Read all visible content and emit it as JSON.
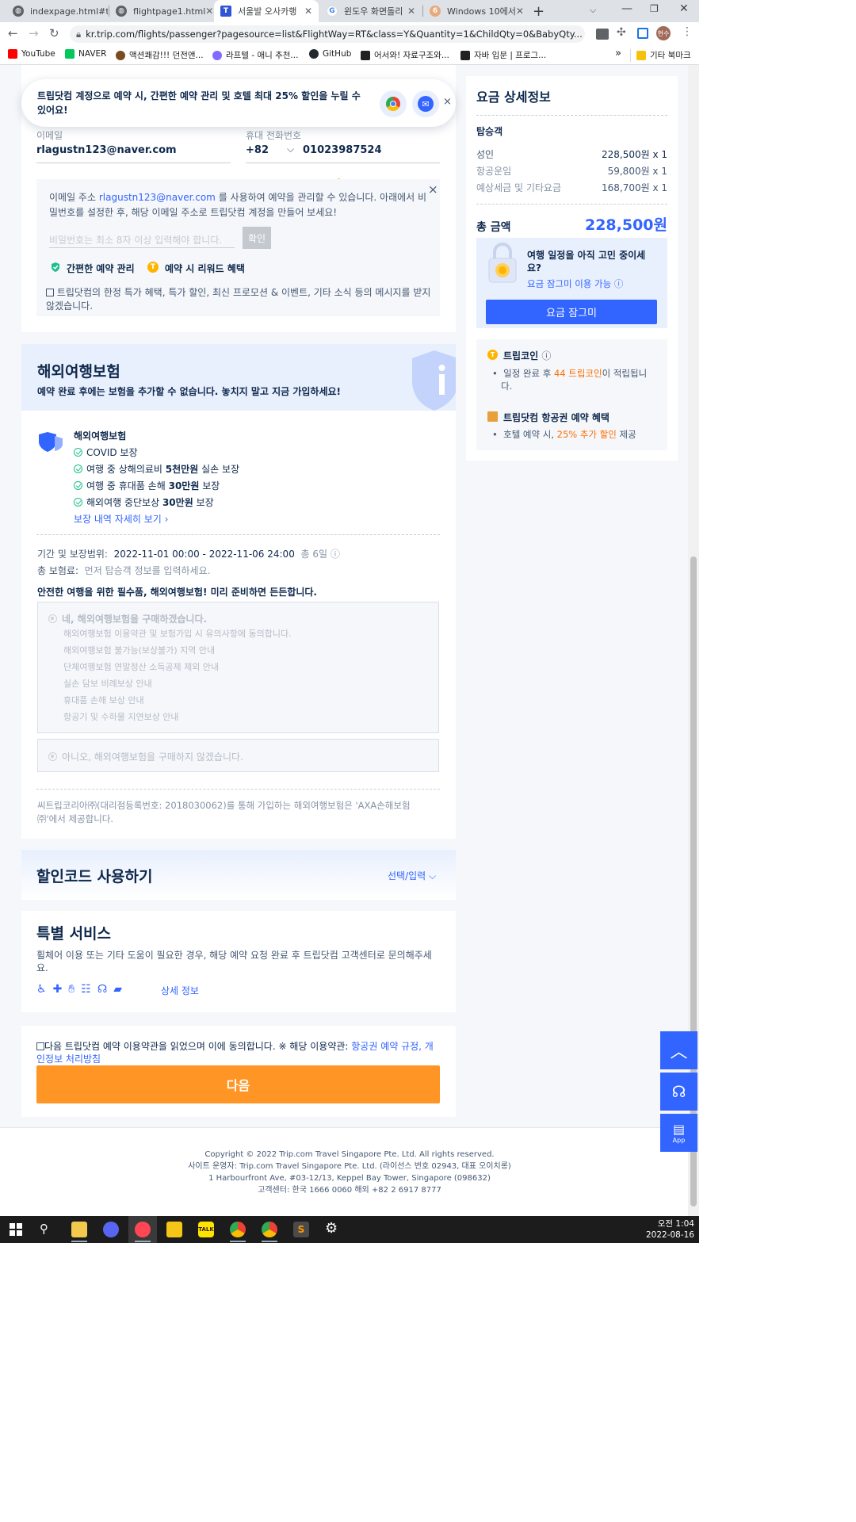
{
  "browser": {
    "tabs": [
      {
        "title": "indexpage.html#t"
      },
      {
        "title": "flightpage1.html"
      },
      {
        "title": "서울발 오사카행"
      },
      {
        "title": "윈도우 화면돌리"
      },
      {
        "title": "Windows 10에서"
      }
    ],
    "url": "kr.trip.com/flights/passenger?pagesource=list&FlightWay=RT&class=Y&Quantity=1&ChildQty=0&BabyQty...",
    "profile": "현수",
    "bookmarks": [
      "YouTube",
      "NAVER",
      "액션쾌감!!! 던전앤...",
      "라프텔 - 애니 추천...",
      "GitHub",
      "어서와! 자료구조와...",
      "자바 입문 | 프로그..."
    ],
    "bookmarks_more": "»",
    "other_bookmarks": "기타 북마크"
  },
  "banner": {
    "text_pre": "트립닷컴 계정으로 예약 시, 간편한 예약 관리 및 호텔 최대 ",
    "text_bold": "25%",
    "text_post": " 할인을 누릴 수",
    "text_line2": "있어요!",
    "close": "×"
  },
  "contact": {
    "email_label": "이메일",
    "email_value": "rlagustn123@naver.com",
    "phone_label": "휴대 전화번호",
    "country_code": "+82",
    "phone_value": "01023987524"
  },
  "account_box": {
    "line1_pre": "이메일 주소 ",
    "line1_email": "rlagustn123@naver.com",
    "line1_post": " 를 사용하여 예약을 관리할 수 있습니다. 아래에서 비",
    "line2": "밀번호를 설정한 후, 해당 이메일 주소로 트립닷컴 계정을 만들어 보세요!",
    "password_placeholder": "비밀번호는 최소 8자 이상 입력해야 합니다.",
    "confirm": "확인",
    "benefit1": "간편한 예약 관리",
    "benefit2": "예약 시 리워드 혜택",
    "marketing_line1": "트립닷컴의 한정 특가 혜택, 특가 할인, 최신 프로모션 & 이벤트, 기타 소식 등의 메시지를 받지",
    "marketing_line2": "않겠습니다."
  },
  "insurance": {
    "title": "해외여행보험",
    "subtitle": "예약 완료 후에는 보험을 추가할 수 없습니다. 놓치지 말고 지금 가입하세요!",
    "product_name": "해외여행보험",
    "features": [
      {
        "pre": "COVID 보장",
        "bold": "",
        "post": ""
      },
      {
        "pre": "여행 중 상해의료비 ",
        "bold": "5천만원",
        "post": " 실손 보장"
      },
      {
        "pre": "여행 중 휴대품 손해 ",
        "bold": "30만원",
        "post": " 보장"
      },
      {
        "pre": "해외여행 중단보상 ",
        "bold": "30만원",
        "post": " 보장"
      }
    ],
    "details_link": "보장 내역 자세히 보기",
    "period_label": "기간 및 보장범위:",
    "period_value": "2022-11-01  00:00  -  2022-11-06  24:00",
    "period_days": "총 6일",
    "premium_label": "총 보험료:",
    "premium_value": "먼저 탑승객 정보를 입력하세요.",
    "promo": "안전한 여행을 위한 필수품, 해외여행보험! 미리 준비하면 든든합니다.",
    "option_yes": "네, 해외여행보험을 구매하겠습니다.",
    "option_yes_items": [
      "해외여행보험 이용약관 및 보험가입 시 유의사항에 동의합니다.",
      "해외여행보험 불가능(보상불가) 지역 안내",
      "단체여행보험 연말정산 소득공제 제외 안내",
      "실손 담보 비례보상 안내",
      "휴대품 손해 보상 안내",
      "항공기 및 수하물 지연보상 안내"
    ],
    "option_no": "아니오, 해외여행보험을 구매하지 않겠습니다.",
    "footnote_line1": "씨트립코리아㈜(대리점등록번호: 2018030062)를 통해 가입하는 해외여행보험은 'AXA손해보험",
    "footnote_line2": "㈜'에서 제공합니다."
  },
  "discount": {
    "title": "할인코드 사용하기",
    "action": "선택/입력"
  },
  "special": {
    "title": "특별 서비스",
    "desc_line1": "휠체어 이용 또는 기타 도움이 필요한 경우, 해당 예약 요청 완료 후 트립닷컴 고객센터로 문의해주세",
    "desc_line2": "요.",
    "details": "상세 정보"
  },
  "terms": {
    "text": "다음 트립닷컴 예약 이용약관을 읽었으며 이에 동의합니다. ※ 해당 이용약관: ",
    "link_line1": "항공권 예약 규정, 개",
    "link_line2": "인정보 처리방침",
    "next_button": "다음"
  },
  "fare": {
    "title": "요금 상세정보",
    "section": "탑승객",
    "rows": [
      {
        "label": "성인",
        "value": "228,500원 x 1"
      },
      {
        "label": "항공운임",
        "value": "59,800원 x 1"
      },
      {
        "label": "예상세금 및 기타요금",
        "value": "168,700원 x 1"
      }
    ],
    "total_label": "총 금액",
    "total_value": "228,500원",
    "lock_title_line1": "여행 일정을 아직 고민 중이세",
    "lock_title_line2": "요?",
    "lock_link": "요금 잠그미 이용 가능",
    "lock_button": "요금 잠그미",
    "coin_title": "트립코인",
    "coin_pre": "일정 완료 후 ",
    "coin_highlight": "44 트립코인",
    "coin_post": "이 적립됩니",
    "coin_line2": "다.",
    "benefit_title": "트립닷컴 항공권 예약 혜택",
    "benefit_pre": "호텔 예약 시, ",
    "benefit_highlight": "25% 추가 할인",
    "benefit_post": " 제공"
  },
  "footer": {
    "lines": [
      "Copyright © 2022 Trip.com Travel Singapore Pte. Ltd. All rights reserved.",
      "사이트 운영자: Trip.com Travel Singapore Pte. Ltd. (라이선스 번호 02943, 대표 오이치롱)",
      "1 Harbourfront Ave, #03-12/13, Keppel Bay Tower, Singapore (098632)",
      "고객센터: 한국 1666 0060 해외 +82 2 6917 8777"
    ]
  },
  "float": {
    "app": "App"
  },
  "taskbar": {
    "time": "오전 1:04",
    "date": "2022-08-16"
  },
  "colors": {
    "brand": "#3264ff",
    "cta": "#ff9524",
    "highlight": "#ff6f00"
  }
}
